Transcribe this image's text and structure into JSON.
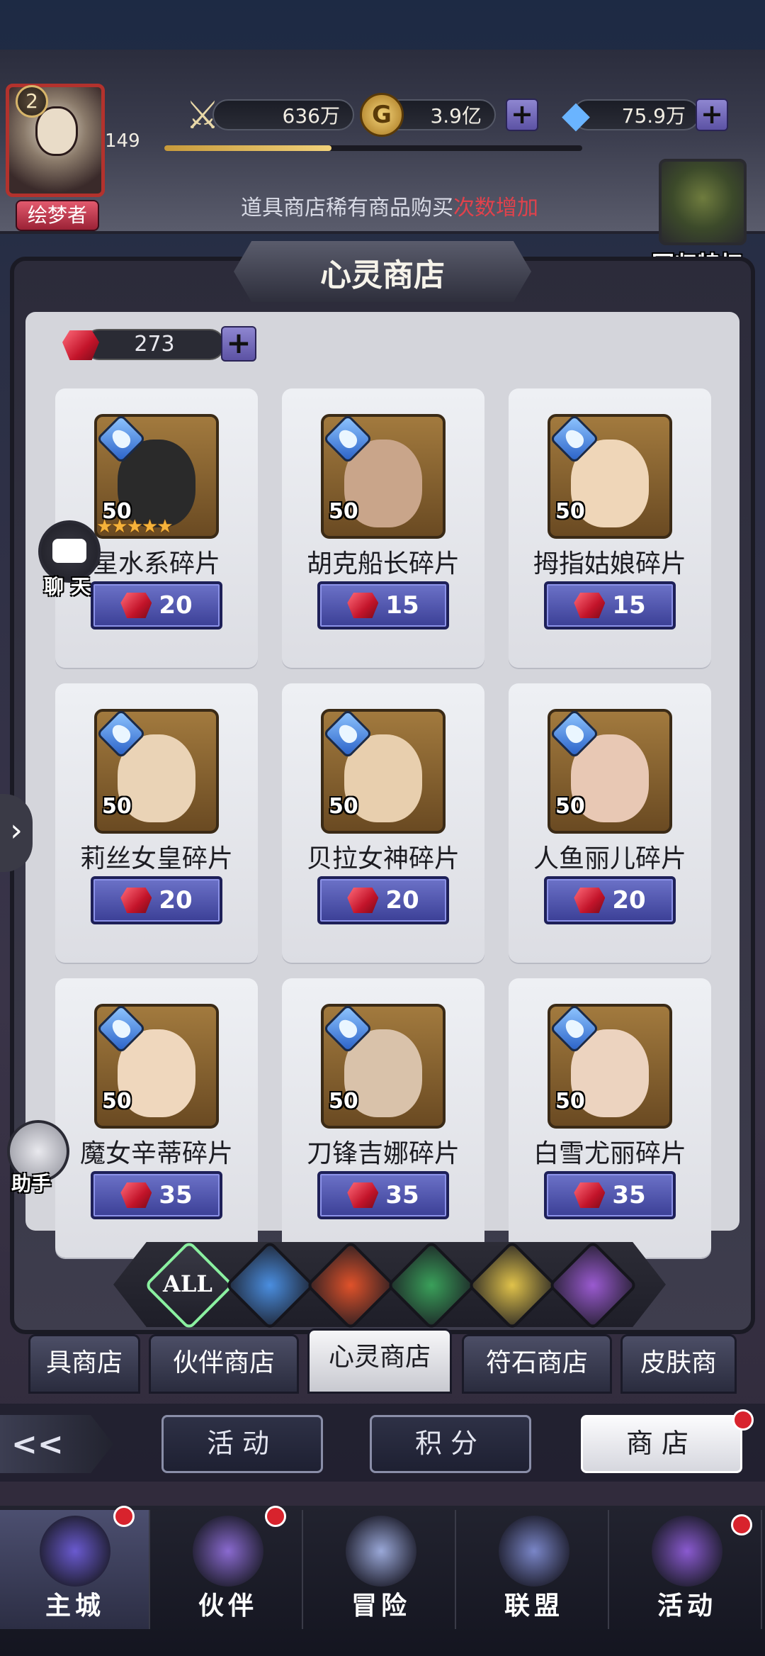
{
  "hud": {
    "power": "636万",
    "gold": "3.9亿",
    "diamonds": "75.9万",
    "player_level": "2",
    "exp_text": "149",
    "exp_progress": 0.4,
    "title_badge": "绘梦者",
    "notice_prefix": "道具商店稀有商品购买",
    "notice_highlight": "次数增加",
    "privilege_label": "回归特权"
  },
  "shop": {
    "title": "心灵商店",
    "currency_amount": "273",
    "items": [
      {
        "name": "星水系碎片",
        "qty": "50",
        "price": "20",
        "stars": "★★★★★",
        "skin": "#2a2a2a",
        "hood": true
      },
      {
        "name": "胡克船长碎片",
        "qty": "50",
        "price": "15",
        "stars": "",
        "skin": "#c9a58a"
      },
      {
        "name": "拇指姑娘碎片",
        "qty": "50",
        "price": "15",
        "stars": "",
        "skin": "#efd6b8"
      },
      {
        "name": "莉丝女皇碎片",
        "qty": "50",
        "price": "20",
        "stars": "",
        "skin": "#ead3b6"
      },
      {
        "name": "贝拉女神碎片",
        "qty": "50",
        "price": "20",
        "stars": "",
        "skin": "#e8cfae"
      },
      {
        "name": "人鱼丽儿碎片",
        "qty": "50",
        "price": "20",
        "stars": "",
        "skin": "#e8c8b4"
      },
      {
        "name": "魔女辛蒂碎片",
        "qty": "50",
        "price": "35",
        "stars": "",
        "skin": "#efd7bd"
      },
      {
        "name": "刀锋吉娜碎片",
        "qty": "50",
        "price": "35",
        "stars": "",
        "skin": "#d9c2aa"
      },
      {
        "name": "白雪尤丽碎片",
        "qty": "50",
        "price": "35",
        "stars": "",
        "skin": "#ecd3bf"
      }
    ]
  },
  "side": {
    "chat_label": "聊 天",
    "assistant_label": "助手",
    "expand_glyph": "›"
  },
  "filters": {
    "all_label": "ALL",
    "elements": [
      {
        "name": "water",
        "color": "#4a8ee0"
      },
      {
        "name": "fire",
        "color": "#e0522a"
      },
      {
        "name": "wind",
        "color": "#3aa05a"
      },
      {
        "name": "light",
        "color": "#e0c24a"
      },
      {
        "name": "dark",
        "color": "#9a5ad0"
      }
    ]
  },
  "shop_tabs": [
    "具商店",
    "伙伴商店",
    "心灵商店",
    "符石商店",
    "皮肤商"
  ],
  "secondary": {
    "back_glyph": "<<",
    "activity": "活动",
    "points": "积分",
    "store": "商店"
  },
  "nav": [
    "主城",
    "伙伴",
    "冒险",
    "联盟",
    "活动"
  ]
}
